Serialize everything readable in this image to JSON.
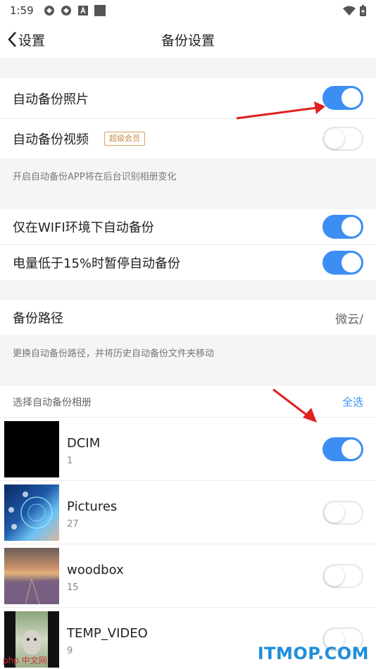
{
  "status": {
    "time": "1:59"
  },
  "nav": {
    "back_label": "设置",
    "title": "备份设置"
  },
  "settings": {
    "auto_photo": {
      "label": "自动备份照片",
      "on": true
    },
    "auto_video": {
      "label": "自动备份视频",
      "badge": "超级会员",
      "on": false
    },
    "note1": "开启自动备份APP将在后台识别相册变化",
    "wifi_only": {
      "label": "仅在WIFI环境下自动备份",
      "on": true
    },
    "low_battery": {
      "label": "电量低于15%时暂停自动备份",
      "on": true
    },
    "path": {
      "label": "备份路径",
      "value": "微云/"
    },
    "note2": "更换自动备份路径，并将历史自动备份文件夹移动"
  },
  "albums_section": {
    "title": "选择自动备份相册",
    "select_all": "全选"
  },
  "albums": [
    {
      "name": "DCIM",
      "count": "1",
      "on": true
    },
    {
      "name": "Pictures",
      "count": "27",
      "on": false
    },
    {
      "name": "woodbox",
      "count": "15",
      "on": false
    },
    {
      "name": "TEMP_VIDEO",
      "count": "9",
      "on": false
    }
  ],
  "watermark": {
    "brand": "ITMOP.COM",
    "left_mark": "php 中文网"
  },
  "colors": {
    "accent": "#3d8ef3",
    "badge": "#c8893d",
    "arrow": "#e02020"
  }
}
